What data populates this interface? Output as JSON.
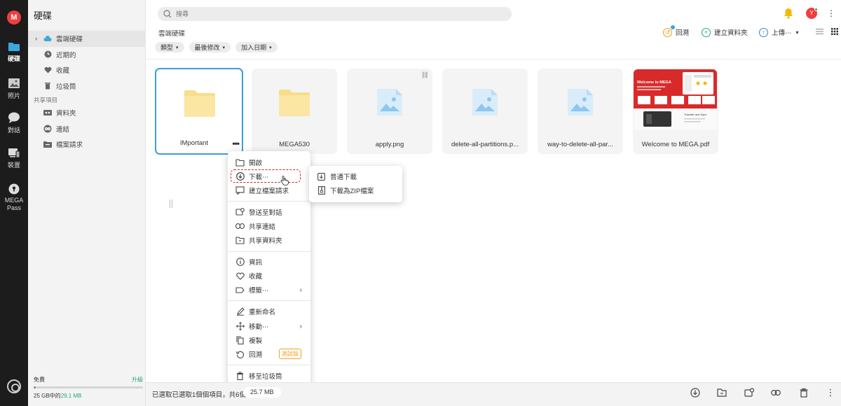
{
  "rail": {
    "logo": "M",
    "items": [
      {
        "label": "硬碟",
        "icon": "folder-icon"
      },
      {
        "label": "照片",
        "icon": "photo-icon"
      },
      {
        "label": "對話",
        "icon": "chat-icon"
      },
      {
        "label": "裝置",
        "icon": "devices-icon"
      },
      {
        "label": "MEGA",
        "label2": "Pass",
        "icon": "pass-icon"
      }
    ]
  },
  "sidebar": {
    "title": "硬碟",
    "items": [
      {
        "label": "雲端硬碟",
        "icon": "cloud-icon"
      },
      {
        "label": "近期的",
        "icon": "clock-icon"
      },
      {
        "label": "收藏",
        "icon": "heart-icon"
      },
      {
        "label": "垃圾筒",
        "icon": "trash-icon"
      }
    ],
    "shared_section": "共享項目",
    "shared_items": [
      {
        "label": "資料夾",
        "icon": "shared-folder-icon"
      },
      {
        "label": "連結",
        "icon": "link-icon"
      },
      {
        "label": "檔案請求",
        "icon": "file-request-icon"
      }
    ],
    "storage": {
      "plan": "免費",
      "upgrade": "升級",
      "used": "25 GB中的",
      "total": "29.1 MB",
      "used_fraction": 0.001
    }
  },
  "header": {
    "search_placeholder": "搜尋",
    "breadcrumb": "雲端硬碟",
    "rewind": "回溯",
    "new_folder": "建立資料夾",
    "upload": "上傳⋯",
    "avatar": "Y"
  },
  "filters": [
    "類型",
    "最後修改",
    "加入日期"
  ],
  "files": [
    {
      "name": "IMportant",
      "type": "folder"
    },
    {
      "name": "MEGA530",
      "type": "folder"
    },
    {
      "name": "apply.png",
      "type": "image"
    },
    {
      "name": "delete-all-partitions.p...",
      "type": "image"
    },
    {
      "name": "way-to-delete-all-par...",
      "type": "image"
    },
    {
      "name": "Welcome to MEGA.pdf",
      "type": "pdf"
    }
  ],
  "pdf_thumb": {
    "heading": "Welcome to MEGA",
    "section": "Transfer and Sync"
  },
  "context_menu": {
    "open": "開啟",
    "download": "下載⋯",
    "file_request": "建立檔案請求",
    "send_chat": "發送至對話",
    "share_link": "共享連結",
    "share_folder": "共享資料夾",
    "info": "資訊",
    "favourite": "收藏",
    "labels": "標籤⋯",
    "rename": "重新命名",
    "move": "移動⋯",
    "copy": "複製",
    "rewind": "回溯",
    "beta": "測試版",
    "trash": "移至垃圾筒"
  },
  "submenu": {
    "normal_download": "普通下載",
    "zip_download": "下載為ZIP檔案"
  },
  "bottom_bar": {
    "selection": "已選取已選取1個個項目，共6個",
    "size": "25.7 MB"
  },
  "colors": {
    "brand": "#f03e3e",
    "selection": "#3aa0d8",
    "upgrade": "#2ba57a",
    "highlight": "#d0202a"
  }
}
